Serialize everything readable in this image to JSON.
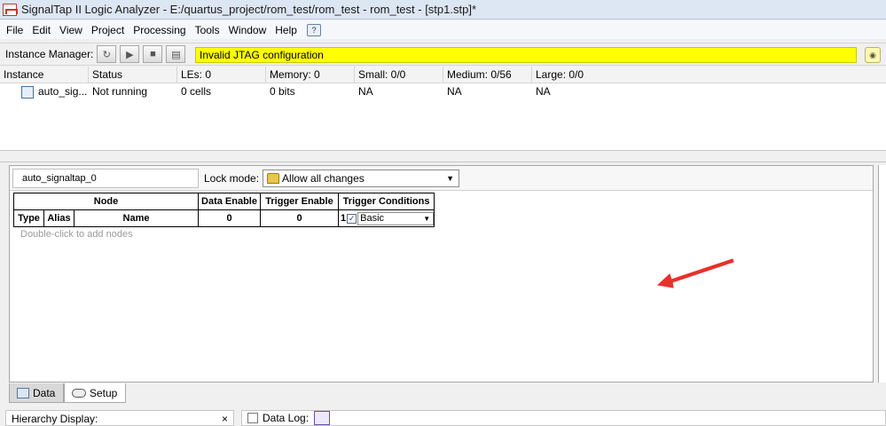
{
  "window": {
    "title": "SignalTap II Logic Analyzer - E:/quartus_project/rom_test/rom_test - rom_test - [stp1.stp]*"
  },
  "menu": [
    "File",
    "Edit",
    "View",
    "Project",
    "Processing",
    "Tools",
    "Window",
    "Help"
  ],
  "instance_manager": {
    "label": "Instance Manager:",
    "status": "Invalid JTAG configuration"
  },
  "instance_table": {
    "headers": [
      "Instance",
      "Status",
      "LEs: 0",
      "Memory: 0",
      "Small: 0/0",
      "Medium: 0/56",
      "Large: 0/0"
    ],
    "rows": [
      [
        "auto_sig...",
        "Not running",
        "0 cells",
        "0 bits",
        "NA",
        "NA",
        "NA"
      ]
    ]
  },
  "setup": {
    "instance_name": "auto_signaltap_0",
    "lock_mode_label": "Lock mode:",
    "lock_mode_value": "Allow all changes",
    "table": {
      "group_headers": [
        "Node",
        "Data Enable",
        "Trigger Enable",
        "Trigger Conditions"
      ],
      "sub_headers": [
        "Type",
        "Alias",
        "Name"
      ],
      "data_enable_count": "0",
      "trigger_enable_count": "0",
      "trigger_index": "1",
      "trigger_type": "Basic"
    },
    "hint": "Double-click to add nodes"
  },
  "tabs": [
    "Data",
    "Setup"
  ],
  "hierarchy": {
    "label": "Hierarchy Display:",
    "close": "×"
  },
  "data_log": {
    "label": "Data Log:"
  },
  "colors": {
    "status_bg": "#ffff00",
    "arrow": "#e8312a"
  }
}
